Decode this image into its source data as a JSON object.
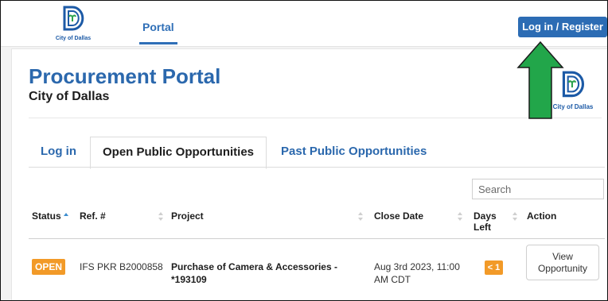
{
  "topbar": {
    "logo_caption": "City of Dallas",
    "nav_portal": "Portal",
    "login_label": "Log in / Register"
  },
  "header": {
    "title": "Procurement Portal",
    "subtitle": "City of Dallas",
    "logo_caption": "City of Dallas"
  },
  "tabs": [
    {
      "label": "Log in",
      "active": false
    },
    {
      "label": "Open Public Opportunities",
      "active": true
    },
    {
      "label": "Past Public Opportunities",
      "active": false
    }
  ],
  "search": {
    "placeholder": "Search",
    "value": ""
  },
  "table": {
    "columns": [
      "Status",
      "Ref. #",
      "Project",
      "Close Date",
      "Days Left",
      "Action"
    ],
    "rows": [
      {
        "status": "OPEN",
        "ref": "IFS PKR B2000858",
        "project": "Purchase of Camera & Accessories - *193109",
        "close_date": "Aug 3rd 2023, 11:00 AM CDT",
        "days_left": "< 1",
        "action": "View Opportunity"
      }
    ]
  },
  "colors": {
    "brand_blue": "#2b68ad",
    "button_blue": "#2c6cb4",
    "badge_orange": "#f29a28",
    "arrow_green": "#22a64a"
  },
  "icons": {
    "logo": "city-of-dallas-logo-icon",
    "sort": "sort-arrows-icon",
    "annotation": "green-up-arrow-icon"
  }
}
